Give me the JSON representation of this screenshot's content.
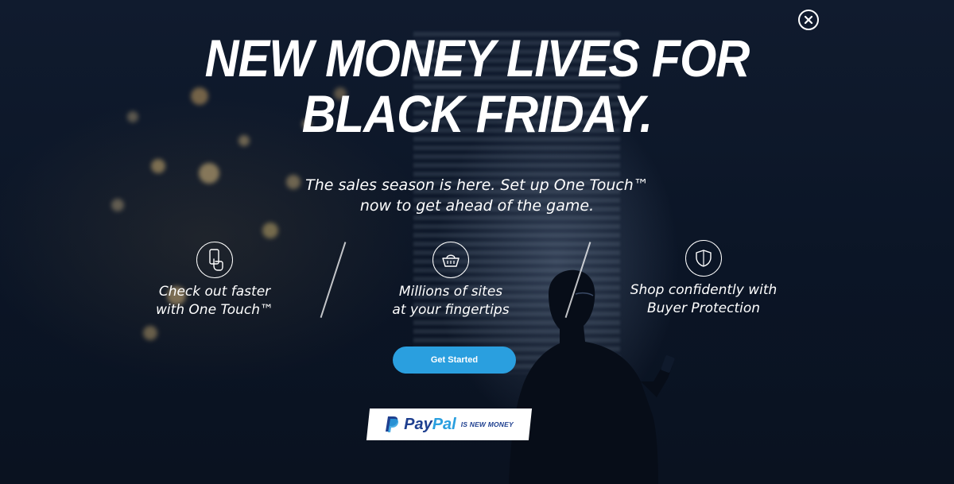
{
  "headline": {
    "line1": "NEW MONEY LIVES FOR",
    "line2": "BLACK FRIDAY."
  },
  "subtext": {
    "line1": "The sales season is here. Set up One Touch™",
    "line2": "now to get ahead of the game."
  },
  "features": [
    {
      "icon": "phone-touch-icon",
      "line1": "Check out faster",
      "line2": "with One Touch™"
    },
    {
      "icon": "shopping-basket-icon",
      "line1": "Millions of sites",
      "line2": "at your fingertips"
    },
    {
      "icon": "shield-icon",
      "line1": "Shop confidently with",
      "line2": "Buyer Protection"
    }
  ],
  "cta": {
    "label": "Get Started"
  },
  "badge": {
    "brand_pay": "Pay",
    "brand_pal": "Pal",
    "tagline": "IS NEW MONEY"
  },
  "close": {
    "icon": "close-icon"
  },
  "colors": {
    "background": "#0b1526",
    "button": "#2a9fdf",
    "brand_dark_blue": "#1e3f8f",
    "brand_light_blue": "#2a9fdf",
    "text": "#ffffff"
  }
}
